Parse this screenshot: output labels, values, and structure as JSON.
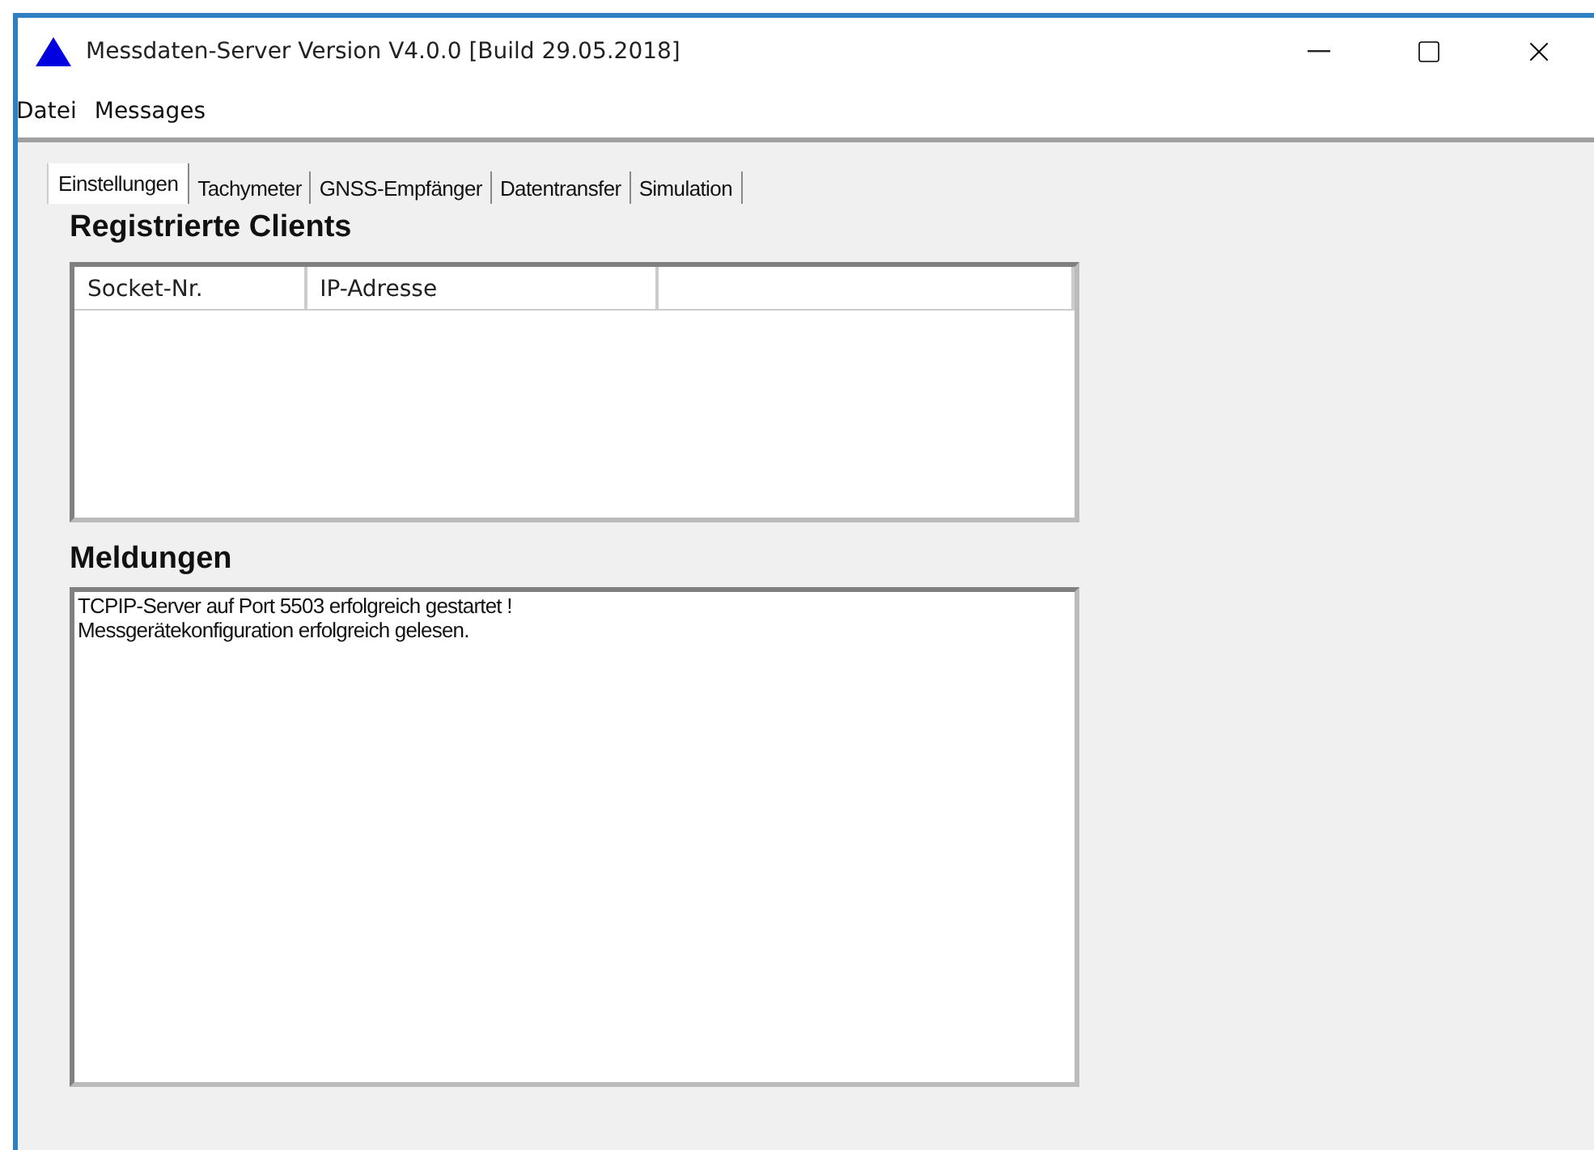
{
  "window": {
    "title": "Messdaten-Server Version V4.0.0 [Build 29.05.2018]"
  },
  "menu": [
    "Datei",
    "Messages"
  ],
  "tabs": [
    {
      "label": "Einstellungen",
      "selected": true
    },
    {
      "label": "Tachymeter",
      "selected": false
    },
    {
      "label": "GNSS-Empfänger",
      "selected": false
    },
    {
      "label": "Datentransfer",
      "selected": false
    },
    {
      "label": "Simulation",
      "selected": false
    }
  ],
  "clients": {
    "heading": "Registrierte Clients",
    "columns": [
      "Socket-Nr.",
      "IP-Adresse"
    ]
  },
  "messages": {
    "heading": "Meldungen",
    "lines": [
      "TCPIP-Server auf Port 5503 erfolgreich gestartet !",
      "Messgerätekonfiguration erfolgreich gelesen."
    ]
  }
}
